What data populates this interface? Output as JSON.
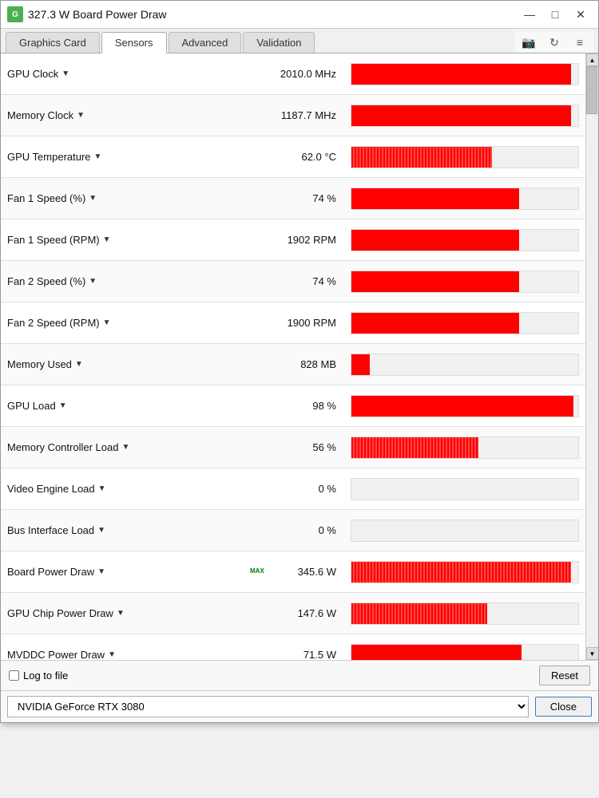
{
  "window": {
    "title": "327.3 W Board Power Draw",
    "icon": "GPU"
  },
  "tabs": [
    {
      "label": "Graphics Card",
      "active": false
    },
    {
      "label": "Sensors",
      "active": true
    },
    {
      "label": "Advanced",
      "active": false
    },
    {
      "label": "Validation",
      "active": false
    }
  ],
  "toolbar": {
    "camera_icon": "📷",
    "refresh_icon": "↻",
    "menu_icon": "≡"
  },
  "sensors": [
    {
      "name": "GPU Clock",
      "value": "2010.0 MHz",
      "bar_pct": 97,
      "noisy": false,
      "has_bar": true,
      "max_badge": false
    },
    {
      "name": "Memory Clock",
      "value": "1187.7 MHz",
      "bar_pct": 97,
      "noisy": false,
      "has_bar": true,
      "max_badge": false
    },
    {
      "name": "GPU Temperature",
      "value": "62.0 °C",
      "bar_pct": 62,
      "noisy": true,
      "has_bar": true,
      "max_badge": false
    },
    {
      "name": "Fan 1 Speed (%)",
      "value": "74 %",
      "bar_pct": 74,
      "noisy": false,
      "has_bar": true,
      "max_badge": false
    },
    {
      "name": "Fan 1 Speed (RPM)",
      "value": "1902 RPM",
      "bar_pct": 74,
      "noisy": false,
      "has_bar": true,
      "max_badge": false
    },
    {
      "name": "Fan 2 Speed (%)",
      "value": "74 %",
      "bar_pct": 74,
      "noisy": false,
      "has_bar": true,
      "max_badge": false
    },
    {
      "name": "Fan 2 Speed (RPM)",
      "value": "1900 RPM",
      "bar_pct": 74,
      "noisy": false,
      "has_bar": true,
      "max_badge": false
    },
    {
      "name": "Memory Used",
      "value": "828 MB",
      "bar_pct": 8,
      "noisy": false,
      "has_bar": true,
      "max_badge": false
    },
    {
      "name": "GPU Load",
      "value": "98 %",
      "bar_pct": 98,
      "noisy": false,
      "has_bar": true,
      "max_badge": false
    },
    {
      "name": "Memory Controller Load",
      "value": "56 %",
      "bar_pct": 56,
      "noisy": true,
      "has_bar": true,
      "max_badge": false
    },
    {
      "name": "Video Engine Load",
      "value": "0 %",
      "bar_pct": 0,
      "noisy": false,
      "has_bar": true,
      "max_badge": false
    },
    {
      "name": "Bus Interface Load",
      "value": "0 %",
      "bar_pct": 0,
      "noisy": false,
      "has_bar": true,
      "max_badge": false
    },
    {
      "name": "Board Power Draw",
      "value": "345.6 W",
      "bar_pct": 97,
      "noisy": true,
      "has_bar": true,
      "max_badge": true
    },
    {
      "name": "GPU Chip Power Draw",
      "value": "147.6 W",
      "bar_pct": 60,
      "noisy": true,
      "has_bar": true,
      "max_badge": false
    },
    {
      "name": "MVDDC Power Draw",
      "value": "71.5 W",
      "bar_pct": 75,
      "noisy": false,
      "has_bar": true,
      "max_badge": false
    }
  ],
  "bottom": {
    "log_label": "Log to file",
    "reset_label": "Reset"
  },
  "footer": {
    "gpu_name": "NVIDIA GeForce RTX 3080",
    "close_label": "Close"
  }
}
